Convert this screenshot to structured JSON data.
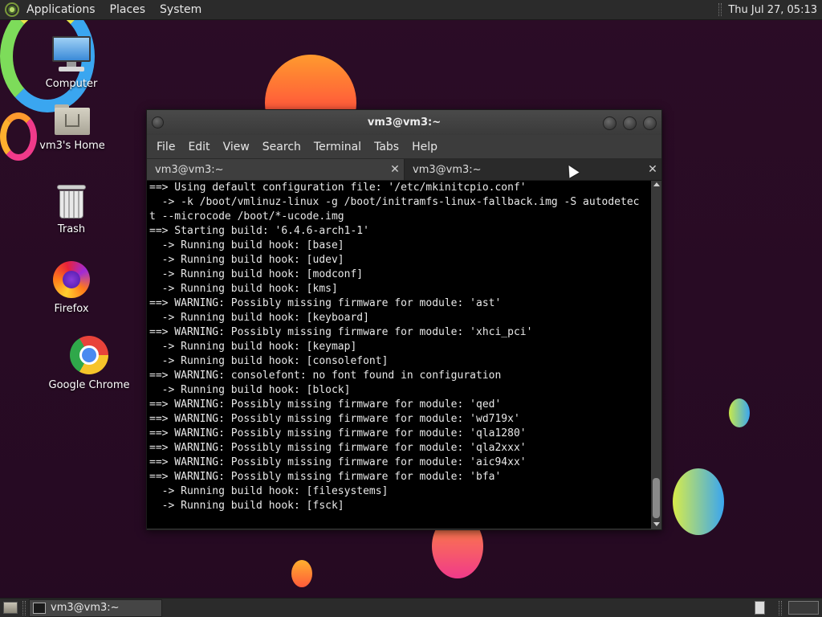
{
  "top_panel": {
    "menus": [
      "Applications",
      "Places",
      "System"
    ],
    "clock": "Thu Jul 27, 05:13"
  },
  "desktop": {
    "icons": [
      {
        "label": "Computer",
        "icon": "computer-icon"
      },
      {
        "label": "vm3's Home",
        "icon": "home-folder-icon"
      },
      {
        "label": "Trash",
        "icon": "trash-icon"
      },
      {
        "label": "Firefox",
        "icon": "firefox-icon"
      },
      {
        "label": "Google Chrome",
        "icon": "chrome-icon"
      }
    ]
  },
  "terminal": {
    "title": "vm3@vm3:~",
    "menu": [
      "File",
      "Edit",
      "View",
      "Search",
      "Terminal",
      "Tabs",
      "Help"
    ],
    "tabs": [
      {
        "label": "vm3@vm3:~",
        "active": false
      },
      {
        "label": "vm3@vm3:~",
        "active": true
      }
    ],
    "lines": [
      "==> Using default configuration file: '/etc/mkinitcpio.conf'",
      "  -> -k /boot/vmlinuz-linux -g /boot/initramfs-linux-fallback.img -S autodetec",
      "t --microcode /boot/*-ucode.img",
      "==> Starting build: '6.4.6-arch1-1'",
      "  -> Running build hook: [base]",
      "  -> Running build hook: [udev]",
      "  -> Running build hook: [modconf]",
      "  -> Running build hook: [kms]",
      "==> WARNING: Possibly missing firmware for module: 'ast'",
      "  -> Running build hook: [keyboard]",
      "==> WARNING: Possibly missing firmware for module: 'xhci_pci'",
      "  -> Running build hook: [keymap]",
      "  -> Running build hook: [consolefont]",
      "==> WARNING: consolefont: no font found in configuration",
      "  -> Running build hook: [block]",
      "==> WARNING: Possibly missing firmware for module: 'qed'",
      "==> WARNING: Possibly missing firmware for module: 'wd719x'",
      "==> WARNING: Possibly missing firmware for module: 'qla1280'",
      "==> WARNING: Possibly missing firmware for module: 'qla2xxx'",
      "==> WARNING: Possibly missing firmware for module: 'aic94xx'",
      "==> WARNING: Possibly missing firmware for module: 'bfa'",
      "  -> Running build hook: [filesystems]",
      "  -> Running build hook: [fsck]"
    ]
  },
  "bottom_panel": {
    "task": "vm3@vm3:~"
  },
  "colors": {
    "wallpaper": "#2a0d24",
    "panel": "#2b2b2b",
    "terminal_bg": "#000000",
    "terminal_fg": "#e8e8e8"
  }
}
